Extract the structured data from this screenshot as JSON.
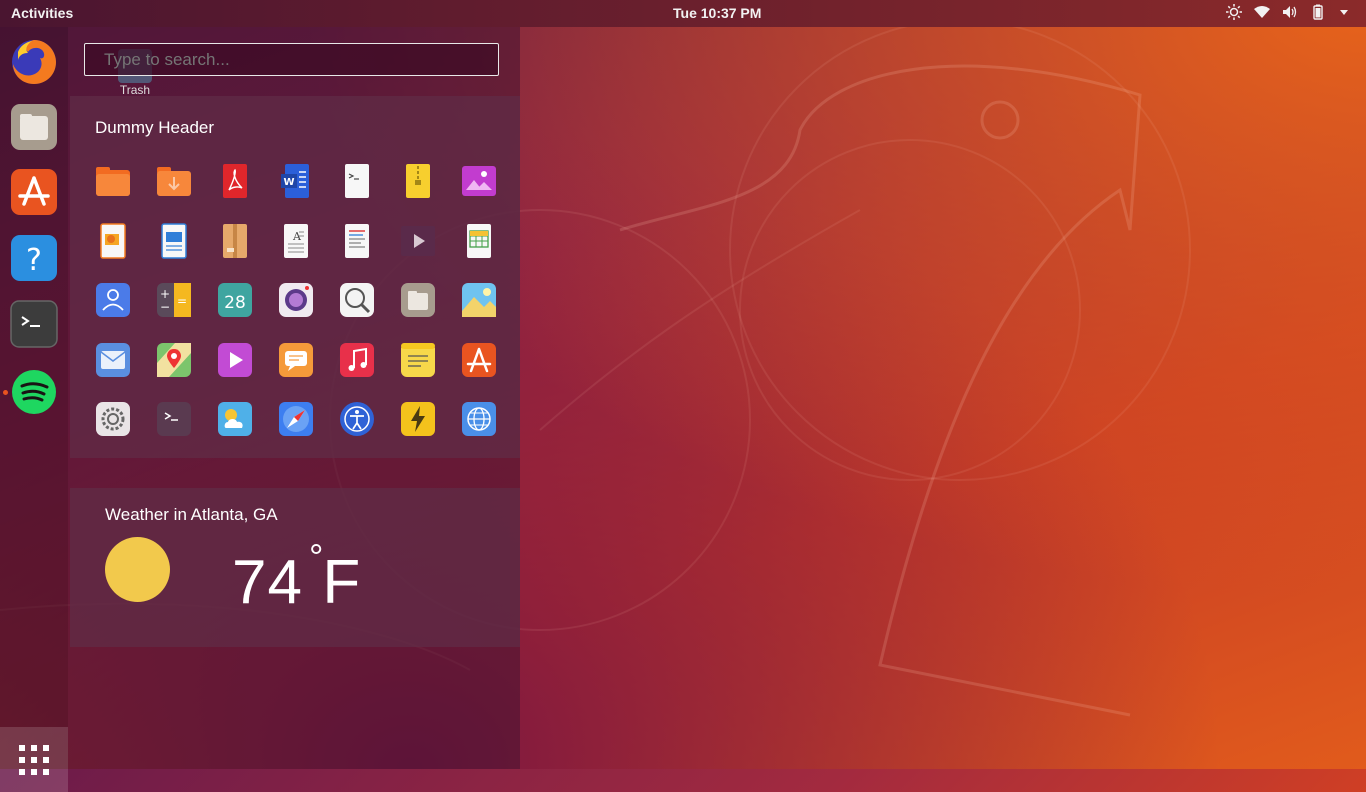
{
  "topbar": {
    "activities": "Activities",
    "clock": "Tue 10:37 PM",
    "tray_icons": [
      "brightness-icon",
      "wifi-icon",
      "volume-icon",
      "battery-icon",
      "menu-down-icon"
    ]
  },
  "dock": {
    "items": [
      {
        "name": "Firefox",
        "icon": "firefox-icon"
      },
      {
        "name": "Files",
        "icon": "files-icon"
      },
      {
        "name": "Ubuntu Software",
        "icon": "software-icon"
      },
      {
        "name": "Help",
        "icon": "help-icon"
      },
      {
        "name": "Terminal",
        "icon": "terminal-icon"
      },
      {
        "name": "Spotify",
        "icon": "spotify-icon",
        "running": true
      }
    ],
    "show_apps_icon": "app-grid-icon"
  },
  "desktop": {
    "trash_label": "Trash"
  },
  "search": {
    "placeholder": "Type to search..."
  },
  "apps_card": {
    "title": "Dummy Header",
    "icons": [
      "folder-icon",
      "folder-download-icon",
      "pdf-icon",
      "word-doc-icon",
      "script-file-icon",
      "archive-icon",
      "image-file-icon",
      "presentation-icon",
      "writer-doc-icon",
      "package-icon",
      "text-file-icon",
      "document-icon",
      "video-file-icon",
      "spreadsheet-icon",
      "contacts-icon",
      "calculator-icon",
      "calendar-icon",
      "camera-icon",
      "search-tool-icon",
      "files-icon",
      "photos-icon",
      "mail-icon",
      "maps-icon",
      "video-player-icon",
      "messages-icon",
      "music-icon",
      "notes-icon",
      "software-store-icon",
      "settings-icon",
      "terminal-icon",
      "weather-icon",
      "safari-compass-icon",
      "accessibility-icon",
      "power-icon",
      "web-browser-icon"
    ]
  },
  "weather": {
    "title": "Weather in Atlanta, GA",
    "temperature": "74",
    "unit": "F",
    "condition_icon": "sun-icon"
  },
  "colors": {
    "accent": "#e95420",
    "sun": "#f2c94c"
  }
}
